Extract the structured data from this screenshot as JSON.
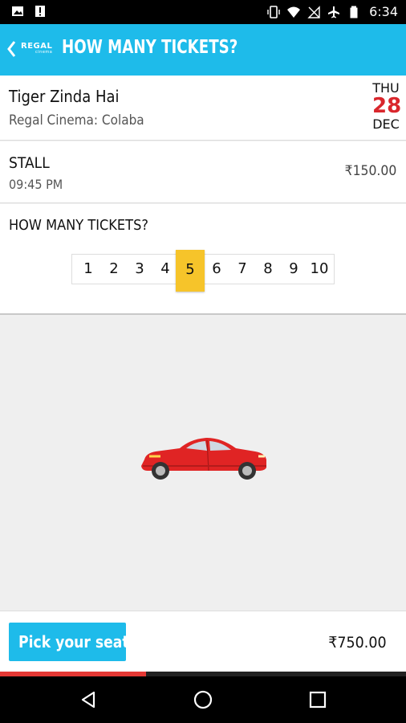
{
  "status_bar": {
    "time": "6:34",
    "icons": [
      "image-icon",
      "alert-icon",
      "vibrate-icon",
      "wifi-icon",
      "no-sim-icon",
      "airplane-icon",
      "battery-icon"
    ]
  },
  "app_bar": {
    "logo_text": "REGAL",
    "logo_subtext": "cinema",
    "title": "HOW MANY TICKETS?",
    "color": "#1ebbea"
  },
  "movie": {
    "title": "Tiger Zinda Hai",
    "cinema": "Regal Cinema: Colaba",
    "date_day": "THU",
    "date_num": "28",
    "date_month": "DEC"
  },
  "seat_class": {
    "name": "STALL",
    "time": "09:45 PM",
    "price": "₹150.00"
  },
  "ticket_count": {
    "label": "HOW MANY TICKETS?",
    "options": [
      "1",
      "2",
      "3",
      "4",
      "5",
      "6",
      "7",
      "8",
      "9",
      "10"
    ],
    "selected": "5",
    "selected_color": "#f6c42a"
  },
  "footer": {
    "button_label": "Pick your seats",
    "total": "₹750.00",
    "progress_fraction": 0.36,
    "progress_color": "#e53935"
  },
  "illustration": {
    "icon": "car-icon",
    "color": "#e02424"
  }
}
